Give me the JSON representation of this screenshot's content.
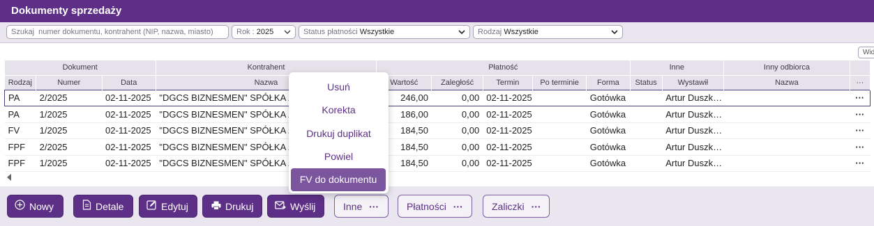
{
  "window": {
    "title": "Dokumenty sprzedaży"
  },
  "filters": {
    "search_placeholder": "Szukaj  numer dokumentu, kontrahent (NIP, nazwa, miasto)",
    "year_label": "Rok :",
    "year_value": "2025",
    "status_label": "Status płatności",
    "status_value": "Wszystkie",
    "kind_label": "Rodzaj",
    "kind_value": "Wszystkie"
  },
  "wid_button": "Wid",
  "table": {
    "groups": {
      "dokument": "Dokument",
      "kontrahent": "Kontrahent",
      "platnosc": "Płatność",
      "inne": "Inne",
      "inny_odbiorca": "Inny odbiorca"
    },
    "columns": {
      "rodzaj": "Rodzaj",
      "numer": "Numer",
      "data": "Data",
      "nazwa": "Nazwa",
      "wartosc": "Wartość",
      "zaleglosc": "Zaległość",
      "termin": "Termin",
      "po_terminie": "Po terminie",
      "forma": "Forma",
      "status": "Status",
      "wystawil": "Wystawił",
      "odbiorca_nazwa": "Nazwa",
      "more": "···"
    },
    "rows": [
      {
        "rodzaj": "PA",
        "numer": "2/2025",
        "data": "02-11-2025",
        "nazwa": "\"DGCS BIZNESMEN\" SPÓŁKA Z OGRANICZONĄ",
        "wartosc": "246,00",
        "zaleglosc": "0,00",
        "termin": "02-11-2025",
        "po_terminie": "",
        "forma": "Gotówka",
        "status": "",
        "wystawil": "Artur Duszk…",
        "odbiorca": "",
        "more": "···"
      },
      {
        "rodzaj": "PA",
        "numer": "1/2025",
        "data": "02-11-2025",
        "nazwa": "\"DGCS BIZNESMEN\" SPÓŁKA Z OGRANICZONĄ",
        "wartosc": "186,00",
        "zaleglosc": "0,00",
        "termin": "02-11-2025",
        "po_terminie": "",
        "forma": "Gotówka",
        "status": "",
        "wystawil": "Artur Duszk…",
        "odbiorca": "",
        "more": "···"
      },
      {
        "rodzaj": "FV",
        "numer": "1/2025",
        "data": "02-11-2025",
        "nazwa": "\"DGCS BIZNESMEN\" SPÓŁKA Z OGRANICZONĄ",
        "wartosc": "184,50",
        "zaleglosc": "0,00",
        "termin": "02-11-2025",
        "po_terminie": "",
        "forma": "Gotówka",
        "status": "",
        "wystawil": "Artur Duszk…",
        "odbiorca": "",
        "more": "···"
      },
      {
        "rodzaj": "FPF",
        "numer": "2/2025",
        "data": "02-11-2025",
        "nazwa": "\"DGCS BIZNESMEN\" SPÓŁKA Z OGRANICZONĄ",
        "wartosc": "184,50",
        "zaleglosc": "0,00",
        "termin": "02-11-2025",
        "po_terminie": "",
        "forma": "Gotówka",
        "status": "",
        "wystawil": "Artur Duszk…",
        "odbiorca": "",
        "more": "···"
      },
      {
        "rodzaj": "FPF",
        "numer": "1/2025",
        "data": "02-11-2025",
        "nazwa": "\"DGCS BIZNESMEN\" SPÓŁKA Z OGRANICZONĄ",
        "wartosc": "184,50",
        "zaleglosc": "0,00",
        "termin": "02-11-2025",
        "po_terminie": "",
        "forma": "Gotówka",
        "status": "",
        "wystawil": "Artur Duszk…",
        "odbiorca": "",
        "more": "···"
      }
    ]
  },
  "context_menu": {
    "items": [
      "Usuń",
      "Korekta",
      "Drukuj duplikat",
      "Powiel",
      "FV do dokumentu"
    ],
    "active_index": 4
  },
  "toolbar": {
    "nowy": "Nowy",
    "detale": "Detale",
    "edytuj": "Edytuj",
    "drukuj": "Drukuj",
    "wyslij": "Wyślij",
    "inne": "Inne",
    "platnosci": "Płatności",
    "zaliczki": "Zaliczki",
    "ellipsis": "···"
  },
  "colors": {
    "brand": "#5d2f86",
    "menu_active": "#7b559e",
    "header_bg": "#e6e2eb",
    "footer_bg": "#eae6f0"
  },
  "icons": [
    "plus-circle-icon",
    "document-icon",
    "edit-icon",
    "printer-icon",
    "mail-send-icon",
    "chevron-down-icon",
    "scroll-left-icon"
  ]
}
